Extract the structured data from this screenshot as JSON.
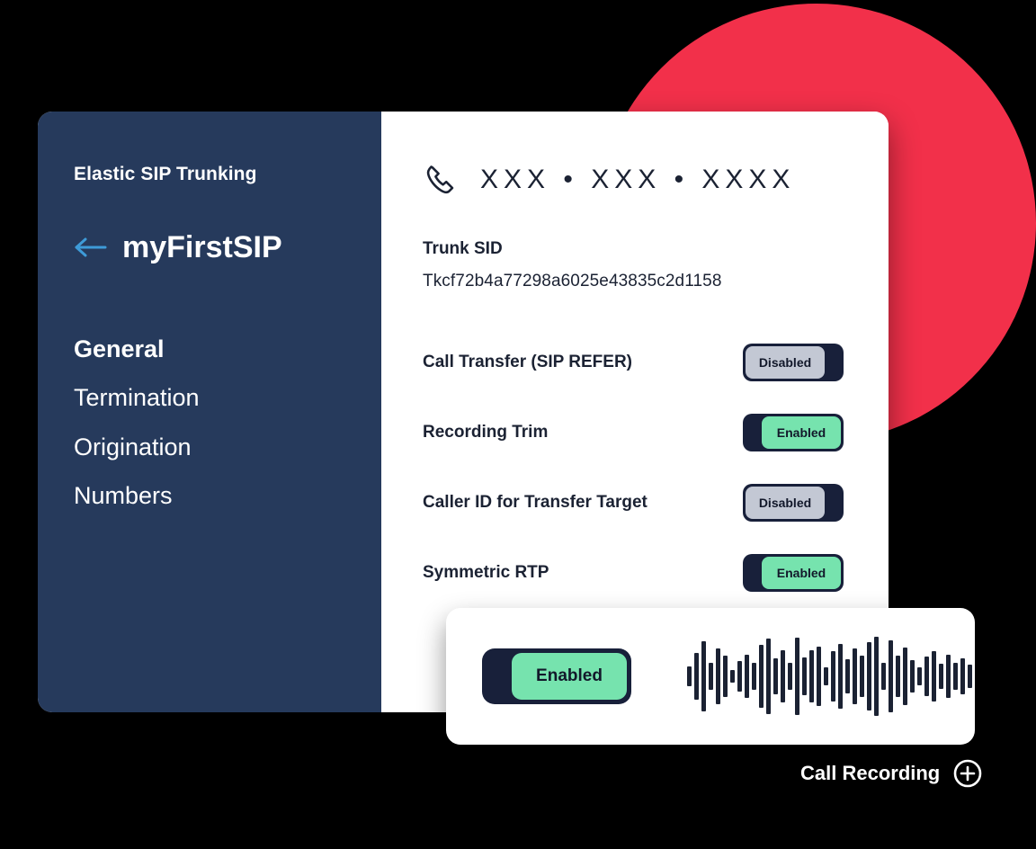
{
  "colors": {
    "sidebar_bg": "#263A5C",
    "accent_red": "#F2304A",
    "toggle_track": "#18203A",
    "toggle_on": "#76E3AE",
    "toggle_off": "#C3C8D4",
    "text_dark": "#1B2233",
    "arrow_blue": "#3E9BD8"
  },
  "sidebar": {
    "brand_title": "Elastic SIP Trunking",
    "back_icon": "arrow-left-icon",
    "trunk_name": "myFirstSIP",
    "items": [
      {
        "label": "General",
        "active": true
      },
      {
        "label": "Termination",
        "active": false
      },
      {
        "label": "Origination",
        "active": false
      },
      {
        "label": "Numbers",
        "active": false
      }
    ]
  },
  "content": {
    "phone_icon": "phone-handset-icon",
    "phone_number": "XXX • XXX • XXXX",
    "trunk_sid_label": "Trunk SID",
    "trunk_sid_value": "Tkcf72b4a77298a6025e43835c2d1158",
    "settings": [
      {
        "label": "Call Transfer (SIP REFER)",
        "state": "Disabled",
        "on": false
      },
      {
        "label": "Recording Trim",
        "state": "Enabled",
        "on": true
      },
      {
        "label": "Caller ID for Transfer Target",
        "state": "Disabled",
        "on": false
      },
      {
        "label": "Symmetric RTP",
        "state": "Enabled",
        "on": true
      }
    ]
  },
  "recording_card": {
    "toggle_state": "Enabled",
    "toggle_on": true,
    "waveform_icon": "audio-waveform-icon",
    "waveform_bars": [
      22,
      52,
      78,
      30,
      62,
      46,
      14,
      34,
      48,
      30,
      70,
      84,
      40,
      58,
      30,
      86,
      42,
      58,
      66,
      20,
      56,
      72,
      38,
      62,
      46,
      76,
      88,
      30,
      80,
      46,
      64,
      36,
      20,
      44,
      56,
      28,
      48,
      30,
      40,
      26
    ]
  },
  "caption": {
    "text": "Call Recording",
    "icon": "info-circle-icon"
  }
}
